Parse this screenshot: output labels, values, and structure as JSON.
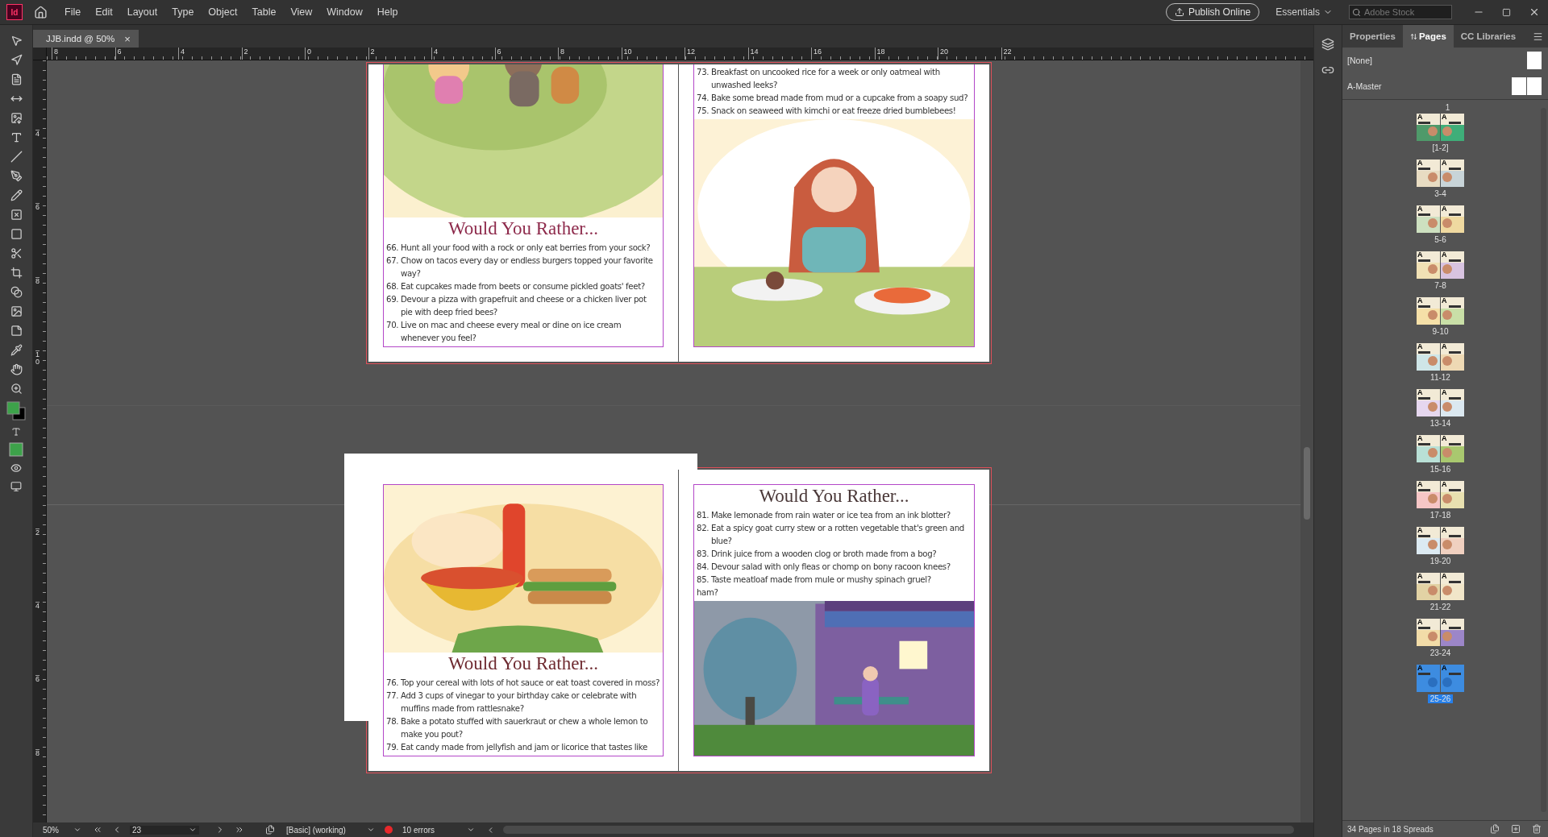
{
  "app": {
    "logo": "Id",
    "menus": [
      "File",
      "Edit",
      "Layout",
      "Type",
      "Object",
      "Table",
      "View",
      "Window",
      "Help"
    ],
    "publish_button": "Publish Online",
    "workspace": "Essentials",
    "search": {
      "placeholder": "Adobe Stock"
    }
  },
  "document_tab": {
    "title": "JJB.indd @ 50%",
    "close": "×"
  },
  "rulers": {
    "horizontal": [
      "8",
      "6",
      "4",
      "2",
      "0",
      "2",
      "4",
      "6",
      "8",
      "10",
      "12",
      "14",
      "16",
      "18",
      "20",
      "22"
    ],
    "vertical": [
      [
        "4",
        "6",
        "8",
        "10"
      ],
      [
        "2",
        "4",
        "6",
        "8"
      ]
    ]
  },
  "spreads": [
    {
      "pages": [
        {
          "blocks": [
            {
              "kind": "picture"
            },
            {
              "kind": "title",
              "text": "Would You Rather...",
              "color": "#8e2b4c"
            },
            {
              "kind": "list",
              "items": [
                "66. Hunt all your food with a rock or only eat berries from your sock?",
                "67. Chow on tacos every day or endless burgers topped your favorite way?",
                "68. Eat cupcakes made from beets or consume pickled goats' feet?",
                "69. Devour a pizza with grapefruit and cheese or a chicken liver pot pie with deep fried bees?",
                "70. Live on mac and cheese every meal or dine on ice cream whenever you feel?"
              ]
            }
          ]
        },
        {
          "blocks": [
            {
              "kind": "list",
              "items": [
                "73. Breakfast on uncooked rice for a week or only oatmeal with unwashed leeks?",
                "74. Bake some bread made from mud or a cupcake from a soapy sud?",
                "75. Snack on seaweed with kimchi or eat freeze dried bumblebees!"
              ]
            },
            {
              "kind": "picture"
            }
          ]
        }
      ]
    },
    {
      "pages": [
        {
          "blocks": [
            {
              "kind": "picture"
            },
            {
              "kind": "title",
              "text": "Would You Rather...",
              "color": "#6e2a30"
            },
            {
              "kind": "list",
              "items": [
                "76. Top your cereal with lots of hot sauce or eat toast covered in moss?",
                "77. Add 3 cups of vinegar to your birthday cake or celebrate with muffins made from rattlesnake?",
                "78. Bake a potato stuffed with sauerkraut or chew a whole lemon to make you pout?",
                "79. Eat candy made from jellyfish and jam or licorice that tastes like"
              ]
            }
          ]
        },
        {
          "blocks": [
            {
              "kind": "title",
              "text": "Would You Rather...",
              "color": "#4a3838"
            },
            {
              "kind": "list",
              "items": [
                "81. Make lemonade from rain water or ice tea from an ink blotter?",
                "82. Eat a spicy goat curry stew or a rotten vegetable that's green and blue?",
                "83.  Drink juice from a wooden clog or broth made from a bog?",
                "84.  Devour salad with only fleas or chomp on bony racoon knees?",
                "85. Taste meatloaf made from mule or mushy spinach gruel?",
                "ham?"
              ]
            },
            {
              "kind": "picture"
            }
          ]
        }
      ]
    }
  ],
  "status_bar": {
    "zoom": "50%",
    "page": "23",
    "style": "[Basic] (working)",
    "errors": "10 errors"
  },
  "pages_panel": {
    "tabs": [
      {
        "label": "Properties",
        "selected": false
      },
      {
        "label": "Pages",
        "selected": true
      },
      {
        "label": "CC Libraries",
        "selected": false
      }
    ],
    "masters": [
      {
        "name": "[None]",
        "kind": "single"
      },
      {
        "name": "A-Master",
        "kind": "facing"
      }
    ],
    "first_page": "1",
    "spreads": [
      {
        "label": "[1-2]",
        "marks": [
          "A",
          "A"
        ],
        "selected": false
      },
      {
        "label": "3-4",
        "marks": [
          "A",
          "A"
        ],
        "selected": false
      },
      {
        "label": "5-6",
        "marks": [
          "A",
          "A"
        ],
        "selected": false
      },
      {
        "label": "7-8",
        "marks": [
          "A",
          "A"
        ],
        "selected": false
      },
      {
        "label": "9-10",
        "marks": [
          "A",
          "A"
        ],
        "selected": false
      },
      {
        "label": "11-12",
        "marks": [
          "A",
          "A"
        ],
        "selected": false
      },
      {
        "label": "13-14",
        "marks": [
          "A",
          "A"
        ],
        "selected": false
      },
      {
        "label": "15-16",
        "marks": [
          "A",
          "A"
        ],
        "selected": false
      },
      {
        "label": "17-18",
        "marks": [
          "A",
          "A"
        ],
        "selected": false
      },
      {
        "label": "19-20",
        "marks": [
          "A",
          "A"
        ],
        "selected": false
      },
      {
        "label": "21-22",
        "marks": [
          "A",
          "A"
        ],
        "selected": false
      },
      {
        "label": "23-24",
        "marks": [
          "A",
          "A"
        ],
        "selected": false
      },
      {
        "label": "25-26",
        "marks": [
          "A",
          "A"
        ],
        "selected": true
      }
    ],
    "footer": "34 Pages in 18 Spreads"
  }
}
